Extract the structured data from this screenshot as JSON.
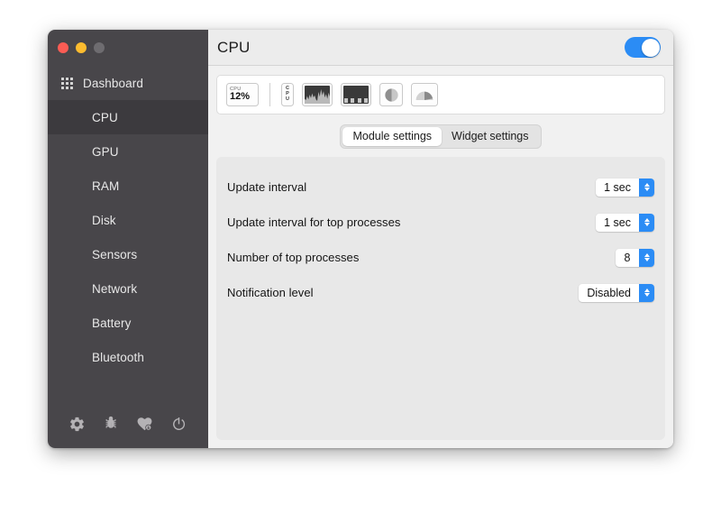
{
  "window": {
    "traffic_lights": [
      "close",
      "minimize",
      "maximize"
    ]
  },
  "sidebar": {
    "dashboard": {
      "label": "Dashboard",
      "icon": "grid-icon"
    },
    "items": [
      {
        "label": "CPU",
        "selected": true
      },
      {
        "label": "GPU",
        "selected": false
      },
      {
        "label": "RAM",
        "selected": false
      },
      {
        "label": "Disk",
        "selected": false
      },
      {
        "label": "Sensors",
        "selected": false
      },
      {
        "label": "Network",
        "selected": false
      },
      {
        "label": "Battery",
        "selected": false
      },
      {
        "label": "Bluetooth",
        "selected": false
      }
    ],
    "footer_icons": [
      {
        "name": "gear-icon",
        "title": "Settings"
      },
      {
        "name": "bug-icon",
        "title": "Report a bug"
      },
      {
        "name": "heart-dollar-icon",
        "title": "Support"
      },
      {
        "name": "power-icon",
        "title": "Quit"
      }
    ],
    "colors": {
      "background": "#48464a",
      "selected": "#3c3a3e",
      "text": "#e8e8e8"
    }
  },
  "header": {
    "title": "CPU",
    "toggle": {
      "name": "module-enable-toggle",
      "state": "on",
      "color": "#2b8cf5"
    }
  },
  "widget_strip": {
    "widgets": [
      {
        "name": "mini-widget",
        "label": "CPU",
        "value": "12%"
      },
      {
        "name": "label-widget",
        "text": "CPU"
      },
      {
        "name": "line-chart-widget"
      },
      {
        "name": "bar-chart-widget"
      },
      {
        "name": "pie-chart-widget"
      },
      {
        "name": "speedometer-widget"
      }
    ]
  },
  "tabs": [
    {
      "label": "Module settings",
      "active": true
    },
    {
      "label": "Widget settings",
      "active": false
    }
  ],
  "settings": [
    {
      "label": "Update interval",
      "value": "1 sec"
    },
    {
      "label": "Update interval for top processes",
      "value": "1 sec"
    },
    {
      "label": "Number of top processes",
      "value": "8"
    },
    {
      "label": "Notification level",
      "value": "Disabled"
    }
  ]
}
